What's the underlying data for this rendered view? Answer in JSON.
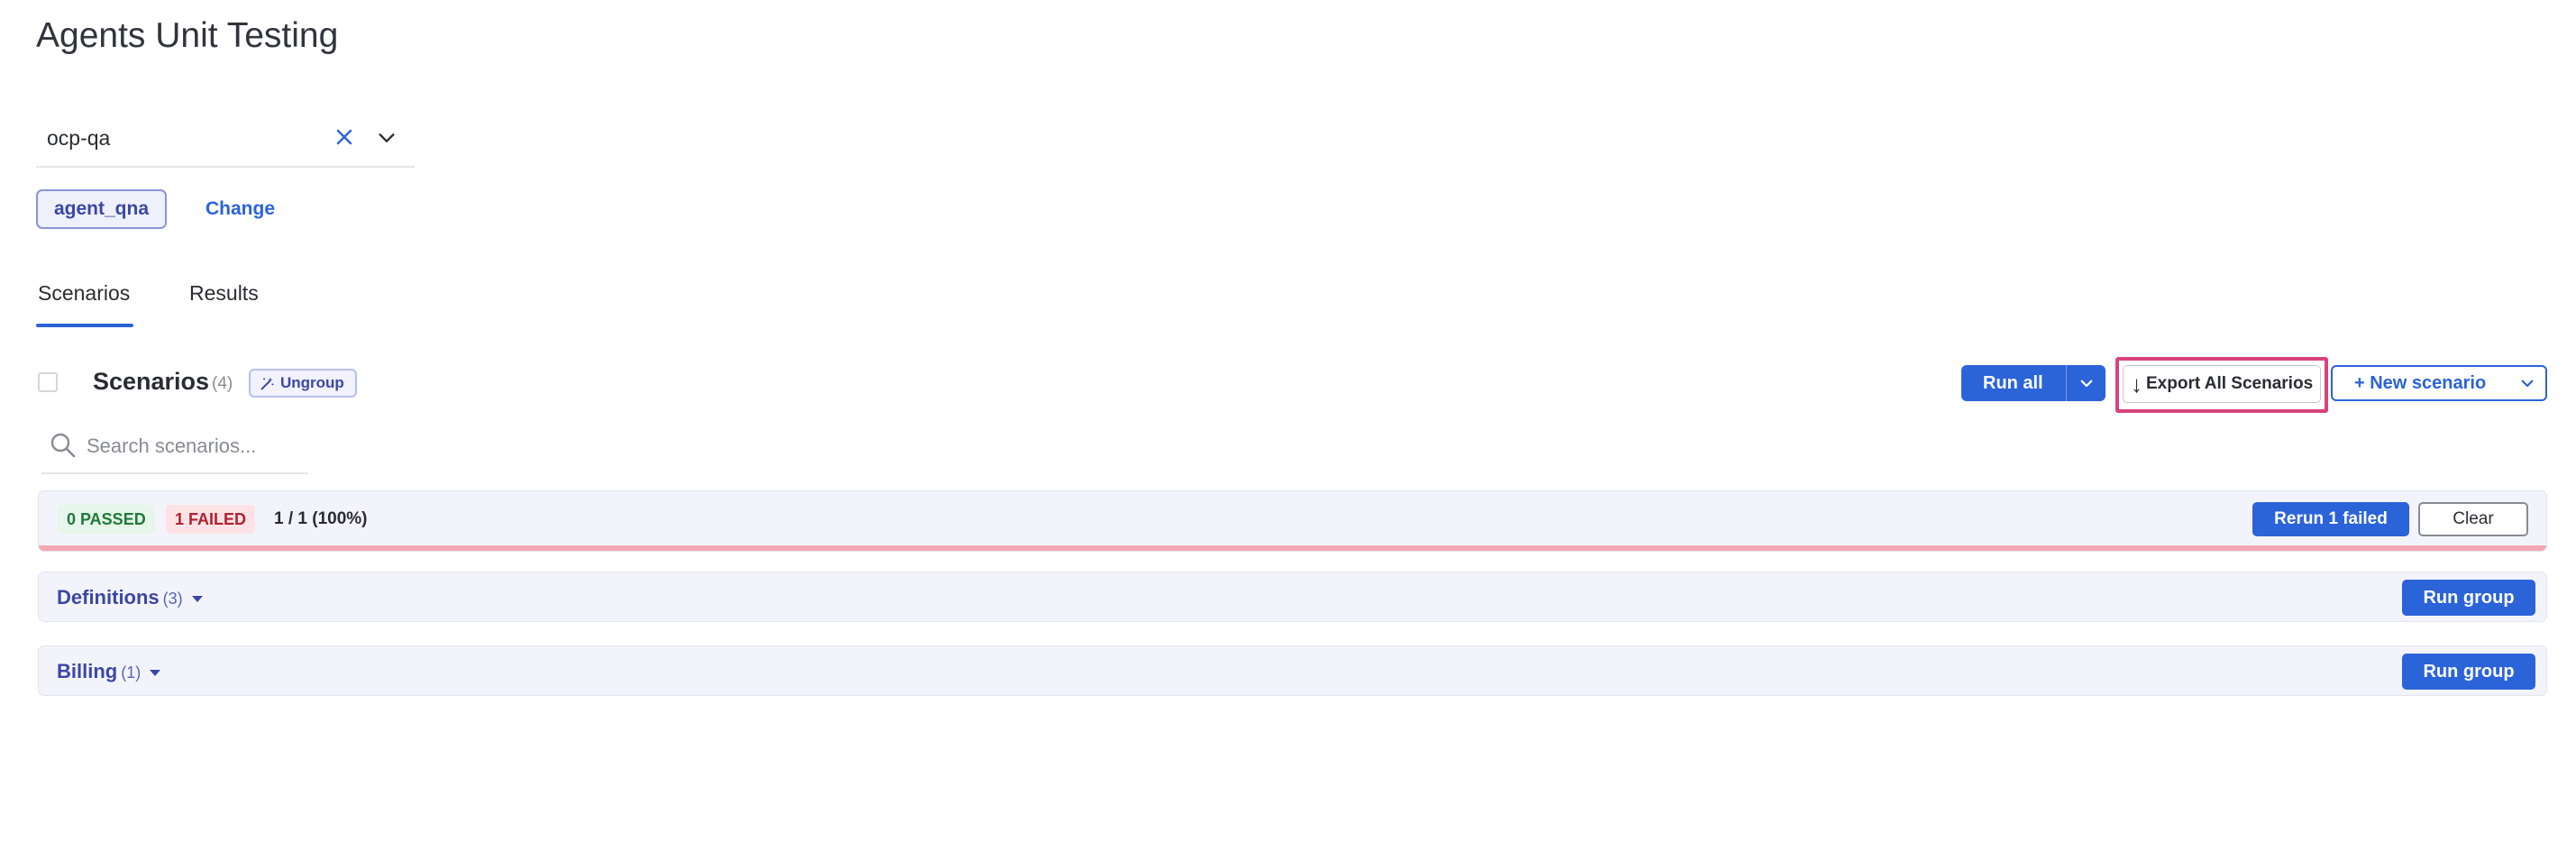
{
  "page": {
    "title": "Agents Unit Testing"
  },
  "org_select": {
    "value": "ocp-qa"
  },
  "agent": {
    "chip_label": "agent_qna",
    "change_label": "Change"
  },
  "tabs": [
    {
      "label": "Scenarios",
      "active": true
    },
    {
      "label": "Results",
      "active": false
    }
  ],
  "scenarios_header": {
    "title": "Scenarios",
    "count": "(4)",
    "ungroup_label": "Ungroup",
    "run_all_label": "Run all",
    "export_label": "Export All Scenarios",
    "export_icon": "↓",
    "new_scenario_label": "+ New scenario"
  },
  "search": {
    "placeholder": "Search scenarios..."
  },
  "results_summary": {
    "passed_label": "0 PASSED",
    "failed_label": "1 FAILED",
    "progress_text": "1 / 1 (100%)",
    "rerun_label": "Rerun 1 failed",
    "clear_label": "Clear"
  },
  "groups": [
    {
      "name": "Definitions",
      "count": "(3)",
      "run_label": "Run group"
    },
    {
      "name": "Billing",
      "count": "(1)",
      "run_label": "Run group"
    }
  ],
  "colors": {
    "primary": "#2b63d9",
    "accent_indigo": "#3b47a6",
    "highlight": "#d7437c",
    "pass_bg": "#e6f6ea",
    "fail_bg": "#fde3e6"
  }
}
